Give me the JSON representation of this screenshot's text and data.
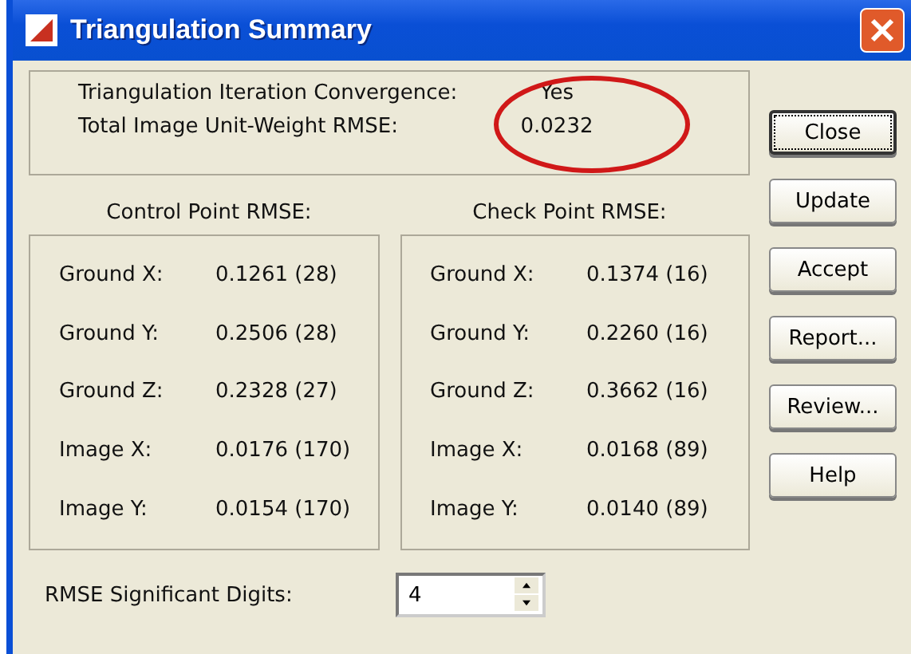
{
  "window": {
    "title": "Triangulation Summary"
  },
  "summary": [
    {
      "label": "Triangulation Iteration Convergence:",
      "value": "Yes"
    },
    {
      "label": "Total Image Unit-Weight RMSE:",
      "value": "0.0232"
    }
  ],
  "panels": [
    {
      "heading": "Control Point RMSE:",
      "rows": [
        {
          "label": "Ground X:",
          "value": "0.1261 (28)"
        },
        {
          "label": "Ground Y:",
          "value": "0.2506 (28)"
        },
        {
          "label": "Ground Z:",
          "value": "0.2328 (27)"
        },
        {
          "label": "Image X:",
          "value": "0.0176 (170)"
        },
        {
          "label": "Image Y:",
          "value": "0.0154 (170)"
        }
      ]
    },
    {
      "heading": "Check Point RMSE:",
      "rows": [
        {
          "label": "Ground X:",
          "value": "0.1374 (16)"
        },
        {
          "label": "Ground Y:",
          "value": "0.2260 (16)"
        },
        {
          "label": "Ground Z:",
          "value": "0.3662 (16)"
        },
        {
          "label": "Image X:",
          "value": "0.0168 (89)"
        },
        {
          "label": "Image Y:",
          "value": "0.0140 (89)"
        }
      ]
    }
  ],
  "buttons": [
    {
      "label": "Close",
      "focused": true
    },
    {
      "label": "Update",
      "focused": false
    },
    {
      "label": "Accept",
      "focused": false
    },
    {
      "label": "Report...",
      "focused": false
    },
    {
      "label": "Review...",
      "focused": false
    },
    {
      "label": "Help",
      "focused": false
    }
  ],
  "digits": {
    "label": "RMSE Significant Digits:",
    "value": "4"
  }
}
